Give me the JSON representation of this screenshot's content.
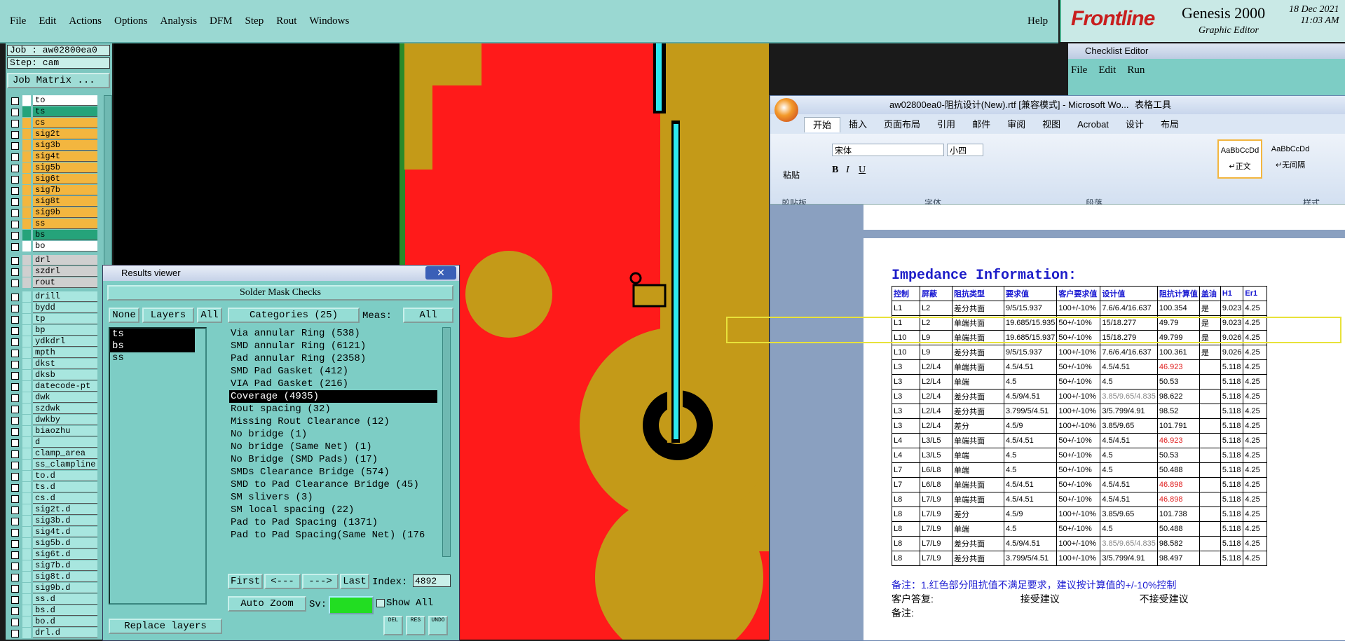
{
  "menubar": {
    "items": [
      "File",
      "Edit",
      "Actions",
      "Options",
      "Analysis",
      "DFM",
      "Step",
      "Rout",
      "Windows"
    ],
    "help": "Help"
  },
  "brand": {
    "logo": "Frontline",
    "product": "Genesis 2000",
    "subtitle": "Graphic Editor",
    "date": "18 Dec 2021",
    "time": "11:03 AM"
  },
  "job": {
    "job_label": "Job : aw02800ea0",
    "step_label": "Step: cam",
    "matrix_button": "Job Matrix ..."
  },
  "layers": [
    {
      "name": "to",
      "color": "#ffffff"
    },
    {
      "name": "ts",
      "color": "#25a37a"
    },
    {
      "name": "cs",
      "color": "#f3b63f"
    },
    {
      "name": "sig2t",
      "color": "#f3b63f"
    },
    {
      "name": "sig3b",
      "color": "#f3b63f"
    },
    {
      "name": "sig4t",
      "color": "#f3b63f"
    },
    {
      "name": "sig5b",
      "color": "#f3b63f"
    },
    {
      "name": "sig6t",
      "color": "#f3b63f"
    },
    {
      "name": "sig7b",
      "color": "#f3b63f"
    },
    {
      "name": "sig8t",
      "color": "#f3b63f"
    },
    {
      "name": "sig9b",
      "color": "#f3b63f"
    },
    {
      "name": "ss",
      "color": "#f3b63f"
    },
    {
      "name": "bs",
      "color": "#25a37a"
    },
    {
      "name": "bo",
      "color": "#ffffff"
    },
    {
      "name": "drl",
      "color": "#cfcfcf"
    },
    {
      "name": "szdrl",
      "color": "#cfcfcf"
    },
    {
      "name": "rout",
      "color": "#cfcfcf"
    },
    {
      "name": "drill",
      "color": "#a8e6df"
    },
    {
      "name": "bydd",
      "color": "#a8e6df"
    },
    {
      "name": "tp",
      "color": "#a8e6df"
    },
    {
      "name": "bp",
      "color": "#a8e6df"
    },
    {
      "name": "ydkdrl",
      "color": "#a8e6df"
    },
    {
      "name": "mpth",
      "color": "#a8e6df"
    },
    {
      "name": "dkst",
      "color": "#a8e6df"
    },
    {
      "name": "dksb",
      "color": "#a8e6df"
    },
    {
      "name": "datecode-pt",
      "color": "#a8e6df"
    },
    {
      "name": "dwk",
      "color": "#a8e6df"
    },
    {
      "name": "szdwk",
      "color": "#a8e6df"
    },
    {
      "name": "dwkby",
      "color": "#a8e6df"
    },
    {
      "name": "biaozhu",
      "color": "#a8e6df"
    },
    {
      "name": "d",
      "color": "#a8e6df"
    },
    {
      "name": "clamp_area",
      "color": "#a8e6df"
    },
    {
      "name": "ss_clampline",
      "color": "#a8e6df"
    },
    {
      "name": "to.d",
      "color": "#a8e6df"
    },
    {
      "name": "ts.d",
      "color": "#a8e6df"
    },
    {
      "name": "cs.d",
      "color": "#a8e6df"
    },
    {
      "name": "sig2t.d",
      "color": "#a8e6df"
    },
    {
      "name": "sig3b.d",
      "color": "#a8e6df"
    },
    {
      "name": "sig4t.d",
      "color": "#a8e6df"
    },
    {
      "name": "sig5b.d",
      "color": "#a8e6df"
    },
    {
      "name": "sig6t.d",
      "color": "#a8e6df"
    },
    {
      "name": "sig7b.d",
      "color": "#a8e6df"
    },
    {
      "name": "sig8t.d",
      "color": "#a8e6df"
    },
    {
      "name": "sig9b.d",
      "color": "#a8e6df"
    },
    {
      "name": "ss.d",
      "color": "#a8e6df"
    },
    {
      "name": "bs.d",
      "color": "#a8e6df"
    },
    {
      "name": "bo.d",
      "color": "#a8e6df"
    },
    {
      "name": "drl.d",
      "color": "#a8e6df"
    }
  ],
  "results_viewer": {
    "title": "Results viewer",
    "header": "Solder Mask Checks",
    "btn_none": "None",
    "btn_layers": "Layers",
    "btn_all": "All",
    "btn_categories": "Categories (25)",
    "meas_label": "Meas:",
    "meas_value": "All",
    "layer_items": [
      "ts",
      "bs",
      "ss"
    ],
    "categories": [
      "Via annular Ring (538)",
      "SMD annular Ring (6121)",
      "Pad annular Ring (2358)",
      "SMD Pad Gasket (412)",
      "VIA Pad Gasket (216)",
      "Coverage (4935)",
      "Rout spacing (32)",
      "Missing Rout Clearance (12)",
      "No bridge (1)",
      "No bridge (Same Net) (1)",
      "No Bridge (SMD Pads) (17)",
      "SMDs Clearance Bridge (574)",
      "SMD to Pad Clearance Bridge (45)",
      "SM slivers (3)",
      "SM local spacing (22)",
      "Pad to Pad Spacing (1371)",
      "Pad to Pad Spacing(Same Net) (176"
    ],
    "selected_category_index": 5,
    "nav_first": "First",
    "nav_prev": "<---",
    "nav_next": "--->",
    "nav_last": "Last",
    "index_label": "Index:",
    "index_value": "4892",
    "auto_zoom": "Auto Zoom",
    "sv_label": "Sv:",
    "show_all": "Show All",
    "replace_layers": "Replace layers",
    "icon_del": "DEL",
    "icon_res": "RES",
    "icon_undo": "UNDO"
  },
  "checklist": {
    "title": "Checklist Editor",
    "menus": [
      "File",
      "Edit",
      "Run"
    ]
  },
  "word": {
    "title": "aw02800ea0-阻抗设计(New).rtf [兼容模式] - Microsoft Wo...",
    "table_tools": "表格工具",
    "tabs": [
      "开始",
      "插入",
      "页面布局",
      "引用",
      "邮件",
      "审阅",
      "视图",
      "Acrobat",
      "设计",
      "布局"
    ],
    "font_name": "宋体",
    "font_size": "小四",
    "paste": "粘贴",
    "groups": [
      "剪贴板",
      "字体",
      "段落",
      "样式"
    ],
    "style_normal": "↵正文",
    "style_nospace": "↵无间隔",
    "style_sample": "AaBbCcDd",
    "doc_title": "Impedance Information:",
    "table_headers": [
      "控制",
      "屏蔽",
      "阻抗类型",
      "要求值",
      "客户要求值",
      "设计值",
      "阻抗计算值",
      "盖油",
      "H1",
      "Er1"
    ],
    "rows": [
      [
        "L1",
        "L2",
        "差分共面",
        "9/5/15.937",
        "100+/-10%",
        "7.6/6.4/16.637",
        "100.354",
        "是",
        "9.023",
        "4.25"
      ],
      [
        "L1",
        "L2",
        "单端共面",
        "19.685/15.935",
        "50+/-10%",
        "15/18.277",
        "49.79",
        "是",
        "9.023",
        "4.25"
      ],
      [
        "L10",
        "L9",
        "单端共面",
        "19.685/15.937",
        "50+/-10%",
        "15/18.279",
        "49.799",
        "是",
        "9.026",
        "4.25"
      ],
      [
        "L10",
        "L9",
        "差分共面",
        "9/5/15.937",
        "100+/-10%",
        "7.6/6.4/16.637",
        "100.361",
        "是",
        "9.026",
        "4.25"
      ],
      [
        "L3",
        "L2/L4",
        "单端共面",
        "4.5/4.51",
        "50+/-10%",
        "4.5/4.51",
        "46.923",
        "",
        "5.118",
        "4.25"
      ],
      [
        "L3",
        "L2/L4",
        "单端",
        "4.5",
        "50+/-10%",
        "4.5",
        "50.53",
        "",
        "5.118",
        "4.25"
      ],
      [
        "L3",
        "L2/L4",
        "差分共面",
        "4.5/9/4.51",
        "100+/-10%",
        "3.85/9.65/4.835",
        "98.622",
        "",
        "5.118",
        "4.25"
      ],
      [
        "L3",
        "L2/L4",
        "差分共面",
        "3.799/5/4.51",
        "100+/-10%",
        "3/5.799/4.91",
        "98.52",
        "",
        "5.118",
        "4.25"
      ],
      [
        "L3",
        "L2/L4",
        "差分",
        "4.5/9",
        "100+/-10%",
        "3.85/9.65",
        "101.791",
        "",
        "5.118",
        "4.25"
      ],
      [
        "L4",
        "L3/L5",
        "单端共面",
        "4.5/4.51",
        "50+/-10%",
        "4.5/4.51",
        "46.923",
        "",
        "5.118",
        "4.25"
      ],
      [
        "L4",
        "L3/L5",
        "单端",
        "4.5",
        "50+/-10%",
        "4.5",
        "50.53",
        "",
        "5.118",
        "4.25"
      ],
      [
        "L7",
        "L6/L8",
        "单端",
        "4.5",
        "50+/-10%",
        "4.5",
        "50.488",
        "",
        "5.118",
        "4.25"
      ],
      [
        "L7",
        "L6/L8",
        "单端共面",
        "4.5/4.51",
        "50+/-10%",
        "4.5/4.51",
        "46.898",
        "",
        "5.118",
        "4.25"
      ],
      [
        "L8",
        "L7/L9",
        "单端共面",
        "4.5/4.51",
        "50+/-10%",
        "4.5/4.51",
        "46.898",
        "",
        "5.118",
        "4.25"
      ],
      [
        "L8",
        "L7/L9",
        "差分",
        "4.5/9",
        "100+/-10%",
        "3.85/9.65",
        "101.738",
        "",
        "5.118",
        "4.25"
      ],
      [
        "L8",
        "L7/L9",
        "单端",
        "4.5",
        "50+/-10%",
        "4.5",
        "50.488",
        "",
        "5.118",
        "4.25"
      ],
      [
        "L8",
        "L7/L9",
        "差分共面",
        "4.5/9/4.51",
        "100+/-10%",
        "3.85/9.65/4.835",
        "98.582",
        "",
        "5.118",
        "4.25"
      ],
      [
        "L8",
        "L7/L9",
        "差分共面",
        "3.799/5/4.51",
        "100+/-10%",
        "3/5.799/4.91",
        "98.497",
        "",
        "5.118",
        "4.25"
      ]
    ],
    "red_rows": [
      4,
      9,
      12,
      13
    ],
    "gray_design_rows": [
      6,
      16
    ],
    "note": "备注：1.红色部分阻抗值不满足要求，建议按计算值的+/-10%控制",
    "customer_reply": "客户答复:",
    "accept": "接受建议",
    "reject": "不接受建议",
    "remark": "备注:"
  },
  "colors": {
    "cam_red": "#ff1a1a",
    "cam_gold": "#c49a18",
    "cam_cyan": "#2ee8f0",
    "panel_teal": "#7dcdc5"
  }
}
